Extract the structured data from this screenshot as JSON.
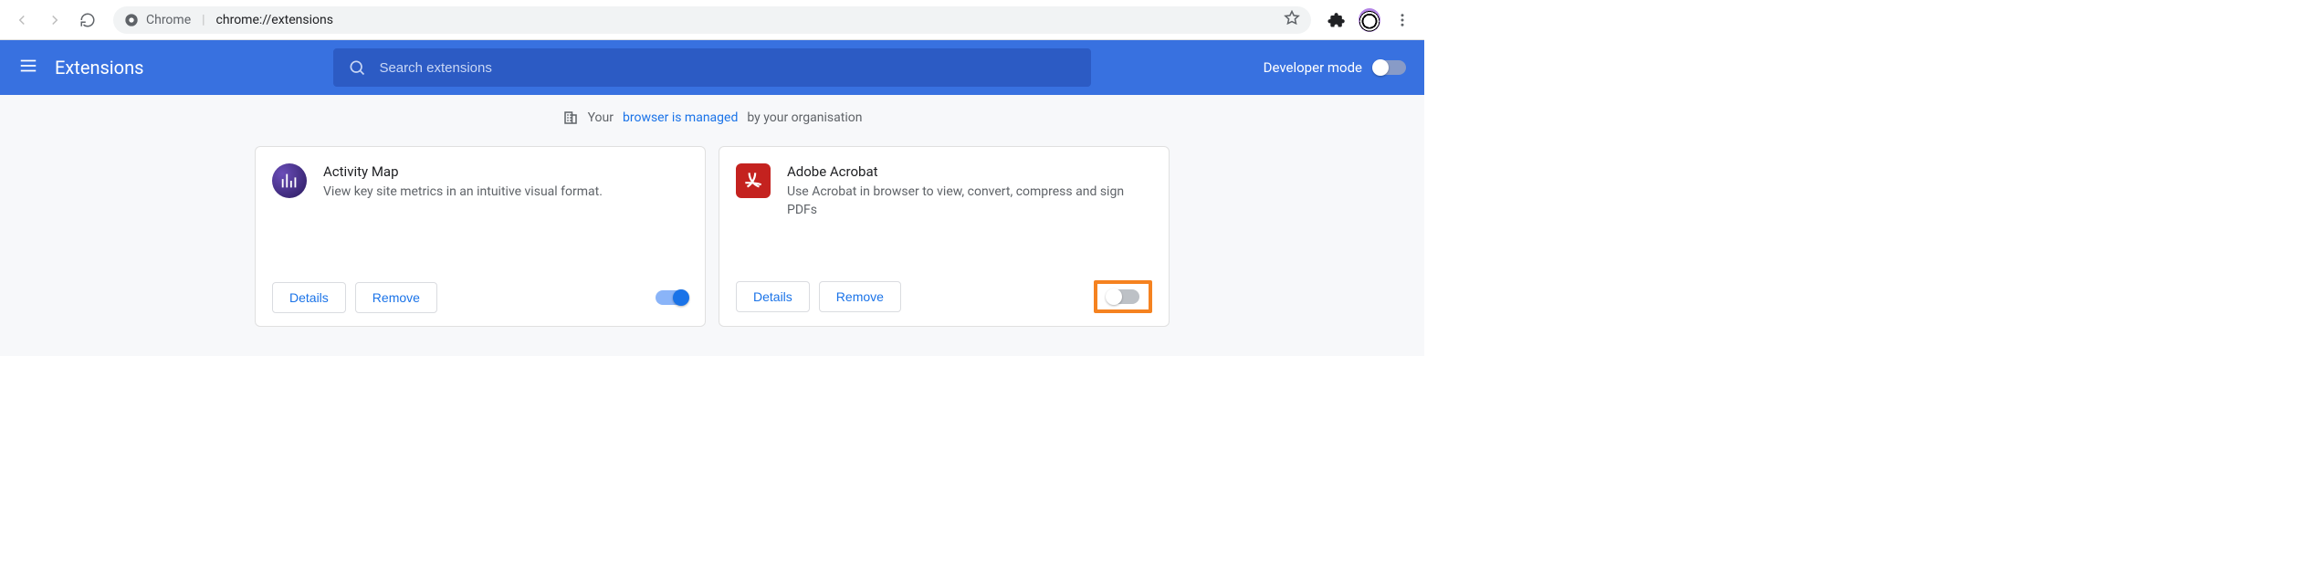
{
  "browser": {
    "product": "Chrome",
    "url": "chrome://extensions"
  },
  "header": {
    "title": "Extensions",
    "search_placeholder": "Search extensions",
    "dev_mode_label": "Developer mode"
  },
  "managed": {
    "prefix": "Your",
    "link": "browser is managed",
    "suffix": "by your organisation"
  },
  "extensions": [
    {
      "name": "Activity Map",
      "desc": "View key site metrics in an intuitive visual format.",
      "details": "Details",
      "remove": "Remove",
      "enabled": true,
      "icon": "activity-map",
      "highlighted": false
    },
    {
      "name": "Adobe Acrobat",
      "desc": "Use Acrobat in browser to view, convert, compress and sign PDFs",
      "details": "Details",
      "remove": "Remove",
      "enabled": false,
      "icon": "acrobat",
      "highlighted": true
    }
  ]
}
